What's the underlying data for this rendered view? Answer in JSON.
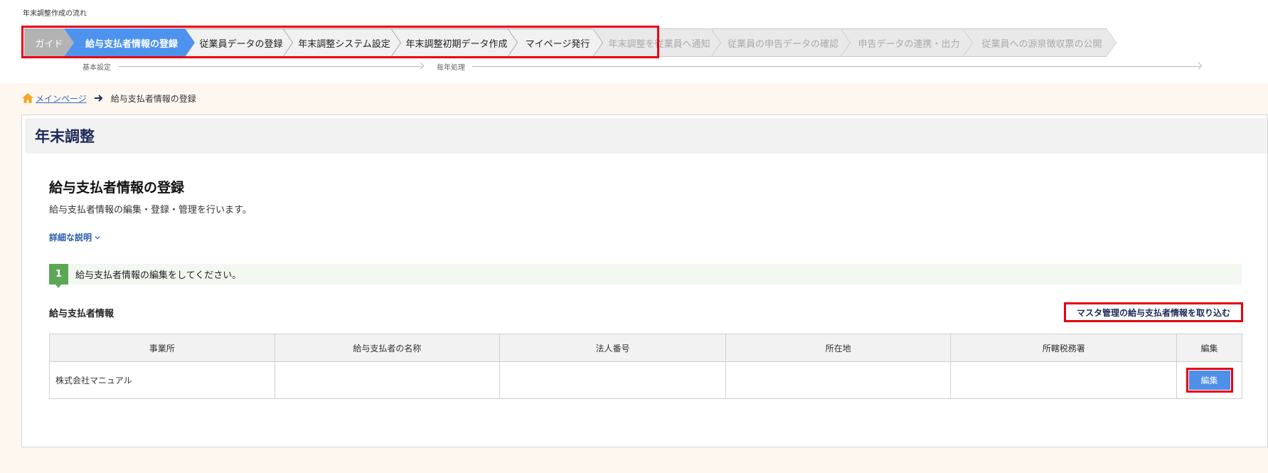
{
  "flow": {
    "title": "年末調整作成の流れ",
    "steps": [
      {
        "label": "ガイド",
        "state": "guide"
      },
      {
        "label": "給与支払者情報の登録",
        "state": "active"
      },
      {
        "label": "従業員データの登録",
        "state": "normal"
      },
      {
        "label": "年末調整システム設定",
        "state": "normal"
      },
      {
        "label": "年末調整初期データ作成",
        "state": "normal"
      },
      {
        "label": "マイページ発行",
        "state": "normal"
      },
      {
        "label": "年末調整を従業員へ通知",
        "state": "disabled"
      },
      {
        "label": "従業員の申告データの確認",
        "state": "disabled"
      },
      {
        "label": "申告データの連携・出力",
        "state": "disabled"
      },
      {
        "label": "従業員への源泉徴収票の公開",
        "state": "disabled"
      }
    ],
    "phases": {
      "basic": "基本設定",
      "yearly": "毎年処理"
    }
  },
  "breadcrumb": {
    "home": "メインページ",
    "current": "給与支払者情報の登録"
  },
  "panel": {
    "title": "年末調整",
    "section_title": "給与支払者情報の登録",
    "section_desc": "給与支払者情報の編集・登録・管理を行います。",
    "detail_link": "詳細な説明",
    "step_number": "1",
    "step_text": "給与支払者情報の編集をしてください。",
    "info_label": "給与支払者情報",
    "import_button": "マスタ管理の給与支払者情報を取り込む"
  },
  "table": {
    "headers": [
      "事業所",
      "給与支払者の名称",
      "法人番号",
      "所在地",
      "所轄税務署",
      "編集"
    ],
    "rows": [
      {
        "office": "株式会社マニュアル",
        "payer_name": "",
        "corp_number": "",
        "address": "",
        "tax_office": "",
        "edit_label": "編集"
      }
    ]
  },
  "colors": {
    "accent": "#4d93ee",
    "highlight": "#e60012",
    "step_green": "#5ba756",
    "title_navy": "#1c2a59"
  }
}
